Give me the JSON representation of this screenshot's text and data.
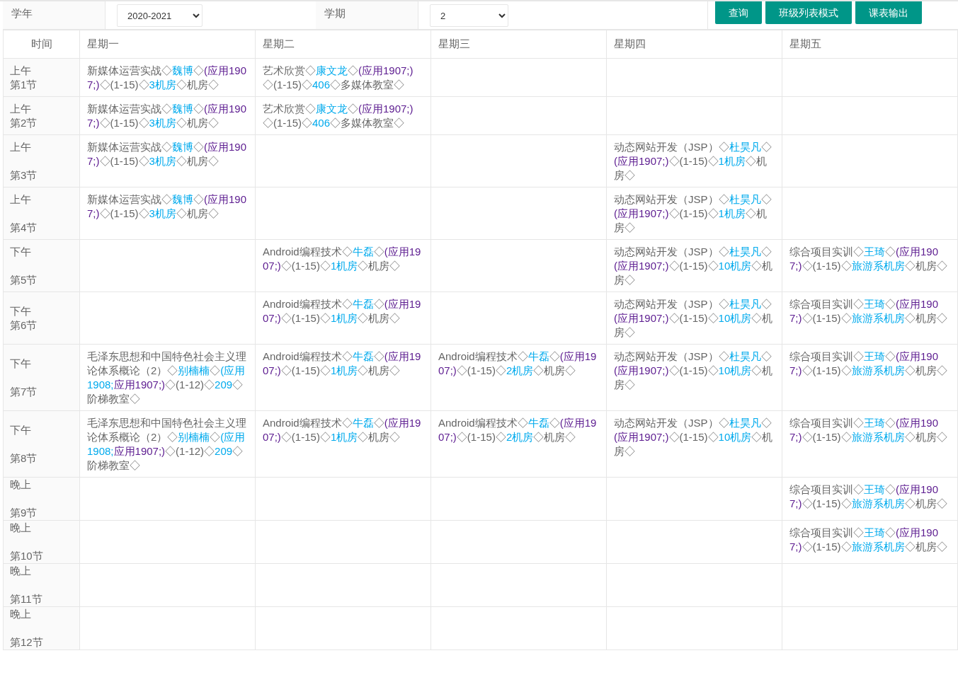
{
  "filters": [
    {
      "label": "学年",
      "value": "2020-2021"
    },
    {
      "label": "学期",
      "value": "2"
    }
  ],
  "buttons": [
    "查询",
    "班级列表模式",
    "课表输出"
  ],
  "table": {
    "columns": [
      "时间",
      "星期一",
      "星期二",
      "星期三",
      "星期四",
      "星期五"
    ],
    "rows": [
      {
        "cells": [
          {
            "part": "上午",
            "period": "第1节",
            "spaced": false
          },
          {
            "segments": [
              {
                "text": "新媒体运营实战◇",
                "kind": "text"
              },
              {
                "text": "魏博",
                "kind": "link"
              },
              {
                "text": "◇",
                "kind": "text"
              },
              {
                "text": "(应用1907;)",
                "kind": "visited"
              },
              {
                "text": "◇(1-15)◇",
                "kind": "text"
              },
              {
                "text": "3机房",
                "kind": "link"
              },
              {
                "text": "◇机房◇",
                "kind": "text"
              }
            ]
          },
          {
            "segments": [
              {
                "text": "艺术欣赏◇",
                "kind": "text"
              },
              {
                "text": "康文龙",
                "kind": "link"
              },
              {
                "text": "◇",
                "kind": "text"
              },
              {
                "text": "(应用1907;)",
                "kind": "visited"
              },
              {
                "text": "◇(1-15)◇",
                "kind": "text"
              },
              {
                "text": "406",
                "kind": "link"
              },
              {
                "text": "◇多媒体教室◇",
                "kind": "text"
              }
            ]
          },
          {},
          {},
          {}
        ]
      },
      {
        "cells": [
          {
            "part": "上午",
            "period": "第2节",
            "spaced": false
          },
          {
            "segments": [
              {
                "text": "新媒体运营实战◇",
                "kind": "text"
              },
              {
                "text": "魏博",
                "kind": "link"
              },
              {
                "text": "◇",
                "kind": "text"
              },
              {
                "text": "(应用1907;)",
                "kind": "visited"
              },
              {
                "text": "◇(1-15)◇",
                "kind": "text"
              },
              {
                "text": "3机房",
                "kind": "link"
              },
              {
                "text": "◇机房◇",
                "kind": "text"
              }
            ]
          },
          {
            "segments": [
              {
                "text": "艺术欣赏◇",
                "kind": "text"
              },
              {
                "text": "康文龙",
                "kind": "link"
              },
              {
                "text": "◇",
                "kind": "text"
              },
              {
                "text": "(应用1907;)",
                "kind": "visited"
              },
              {
                "text": "◇(1-15)◇",
                "kind": "text"
              },
              {
                "text": "406",
                "kind": "link"
              },
              {
                "text": "◇多媒体教室◇",
                "kind": "text"
              }
            ]
          },
          {},
          {},
          {}
        ]
      },
      {
        "cells": [
          {
            "part": "上午",
            "period": "第3节",
            "spaced": true
          },
          {
            "segments": [
              {
                "text": "新媒体运营实战◇",
                "kind": "text"
              },
              {
                "text": "魏博",
                "kind": "link"
              },
              {
                "text": "◇",
                "kind": "text"
              },
              {
                "text": "(应用1907;)",
                "kind": "visited"
              },
              {
                "text": "◇(1-15)◇",
                "kind": "text"
              },
              {
                "text": "3机房",
                "kind": "link"
              },
              {
                "text": "◇机房◇",
                "kind": "text"
              }
            ]
          },
          {},
          {},
          {
            "segments": [
              {
                "text": "动态网站开发（JSP）◇",
                "kind": "text"
              },
              {
                "text": "杜昊凡",
                "kind": "link"
              },
              {
                "text": "◇",
                "kind": "text"
              },
              {
                "text": "(应用1907;)",
                "kind": "visited"
              },
              {
                "text": "◇(1-15)◇",
                "kind": "text"
              },
              {
                "text": "1机房",
                "kind": "link"
              },
              {
                "text": "◇机房◇",
                "kind": "text"
              }
            ]
          },
          {}
        ]
      },
      {
        "cells": [
          {
            "part": "上午",
            "period": "第4节",
            "spaced": true
          },
          {
            "segments": [
              {
                "text": "新媒体运营实战◇",
                "kind": "text"
              },
              {
                "text": "魏博",
                "kind": "link"
              },
              {
                "text": "◇",
                "kind": "text"
              },
              {
                "text": "(应用1907;)",
                "kind": "visited"
              },
              {
                "text": "◇(1-15)◇",
                "kind": "text"
              },
              {
                "text": "3机房",
                "kind": "link"
              },
              {
                "text": "◇机房◇",
                "kind": "text"
              }
            ]
          },
          {},
          {},
          {
            "segments": [
              {
                "text": "动态网站开发（JSP）◇",
                "kind": "text"
              },
              {
                "text": "杜昊凡",
                "kind": "link"
              },
              {
                "text": "◇",
                "kind": "text"
              },
              {
                "text": "(应用1907;)",
                "kind": "visited"
              },
              {
                "text": "◇(1-15)◇",
                "kind": "text"
              },
              {
                "text": "1机房",
                "kind": "link"
              },
              {
                "text": "◇机房◇",
                "kind": "text"
              }
            ]
          },
          {}
        ]
      },
      {
        "cells": [
          {
            "part": "下午",
            "period": "第5节",
            "spaced": true
          },
          {},
          {
            "segments": [
              {
                "text": "Android编程技术◇",
                "kind": "text"
              },
              {
                "text": "牛磊",
                "kind": "link"
              },
              {
                "text": "◇",
                "kind": "text"
              },
              {
                "text": "(应用1907;)",
                "kind": "visited"
              },
              {
                "text": "◇(1-15)◇",
                "kind": "text"
              },
              {
                "text": "1机房",
                "kind": "link"
              },
              {
                "text": "◇机房◇",
                "kind": "text"
              }
            ]
          },
          {},
          {
            "segments": [
              {
                "text": "动态网站开发（JSP）◇",
                "kind": "text"
              },
              {
                "text": "杜昊凡",
                "kind": "link"
              },
              {
                "text": "◇",
                "kind": "text"
              },
              {
                "text": "(应用1907;)",
                "kind": "visited"
              },
              {
                "text": "◇(1-15)◇",
                "kind": "text"
              },
              {
                "text": "10机房",
                "kind": "link"
              },
              {
                "text": "◇机房◇",
                "kind": "text"
              }
            ]
          },
          {
            "segments": [
              {
                "text": "综合项目实训◇",
                "kind": "text"
              },
              {
                "text": "王琦",
                "kind": "link"
              },
              {
                "text": "◇",
                "kind": "text"
              },
              {
                "text": "(应用1907;)",
                "kind": "visited"
              },
              {
                "text": "◇(1-15)◇",
                "kind": "text"
              },
              {
                "text": "旅游系机房",
                "kind": "link"
              },
              {
                "text": "◇机房◇",
                "kind": "text"
              }
            ]
          }
        ]
      },
      {
        "cells": [
          {
            "part": "下午",
            "period": "第6节",
            "spaced": false
          },
          {},
          {
            "segments": [
              {
                "text": "Android编程技术◇",
                "kind": "text"
              },
              {
                "text": "牛磊",
                "kind": "link"
              },
              {
                "text": "◇",
                "kind": "text"
              },
              {
                "text": "(应用1907;)",
                "kind": "visited"
              },
              {
                "text": "◇(1-15)◇",
                "kind": "text"
              },
              {
                "text": "1机房",
                "kind": "link"
              },
              {
                "text": "◇机房◇",
                "kind": "text"
              }
            ]
          },
          {},
          {
            "segments": [
              {
                "text": "动态网站开发（JSP）◇",
                "kind": "text"
              },
              {
                "text": "杜昊凡",
                "kind": "link"
              },
              {
                "text": "◇",
                "kind": "text"
              },
              {
                "text": "(应用1907;)",
                "kind": "visited"
              },
              {
                "text": "◇(1-15)◇",
                "kind": "text"
              },
              {
                "text": "10机房",
                "kind": "link"
              },
              {
                "text": "◇机房◇",
                "kind": "text"
              }
            ]
          },
          {
            "segments": [
              {
                "text": "综合项目实训◇",
                "kind": "text"
              },
              {
                "text": "王琦",
                "kind": "link"
              },
              {
                "text": "◇",
                "kind": "text"
              },
              {
                "text": "(应用1907;)",
                "kind": "visited"
              },
              {
                "text": "◇(1-15)◇",
                "kind": "text"
              },
              {
                "text": "旅游系机房",
                "kind": "link"
              },
              {
                "text": "◇机房◇",
                "kind": "text"
              }
            ]
          }
        ]
      },
      {
        "cells": [
          {
            "part": "下午",
            "period": "第7节",
            "spaced": true
          },
          {
            "segments": [
              {
                "text": "毛泽东思想和中国特色社会主义理论体系概论（2）◇",
                "kind": "text"
              },
              {
                "text": "别楠楠",
                "kind": "link"
              },
              {
                "text": "◇",
                "kind": "text"
              },
              {
                "text": "(应用1908;",
                "kind": "link"
              },
              {
                "text": "应用1907;)",
                "kind": "visited"
              },
              {
                "text": "◇(1-12)◇",
                "kind": "text"
              },
              {
                "text": "209",
                "kind": "link"
              },
              {
                "text": "◇阶梯教室◇",
                "kind": "text"
              }
            ]
          },
          {
            "segments": [
              {
                "text": "Android编程技术◇",
                "kind": "text"
              },
              {
                "text": "牛磊",
                "kind": "link"
              },
              {
                "text": "◇",
                "kind": "text"
              },
              {
                "text": "(应用1907;)",
                "kind": "visited"
              },
              {
                "text": "◇(1-15)◇",
                "kind": "text"
              },
              {
                "text": "1机房",
                "kind": "link"
              },
              {
                "text": "◇机房◇",
                "kind": "text"
              }
            ]
          },
          {
            "segments": [
              {
                "text": "Android编程技术◇",
                "kind": "text"
              },
              {
                "text": "牛磊",
                "kind": "link"
              },
              {
                "text": "◇",
                "kind": "text"
              },
              {
                "text": "(应用1907;)",
                "kind": "visited"
              },
              {
                "text": "◇(1-15)◇",
                "kind": "text"
              },
              {
                "text": "2机房",
                "kind": "link"
              },
              {
                "text": "◇机房◇",
                "kind": "text"
              }
            ]
          },
          {
            "segments": [
              {
                "text": "动态网站开发（JSP）◇",
                "kind": "text"
              },
              {
                "text": "杜昊凡",
                "kind": "link"
              },
              {
                "text": "◇",
                "kind": "text"
              },
              {
                "text": "(应用1907;)",
                "kind": "visited"
              },
              {
                "text": "◇(1-15)◇",
                "kind": "text"
              },
              {
                "text": "10机房",
                "kind": "link"
              },
              {
                "text": "◇机房◇",
                "kind": "text"
              }
            ]
          },
          {
            "segments": [
              {
                "text": "综合项目实训◇",
                "kind": "text"
              },
              {
                "text": "王琦",
                "kind": "link"
              },
              {
                "text": "◇",
                "kind": "text"
              },
              {
                "text": "(应用1907;)",
                "kind": "visited"
              },
              {
                "text": "◇(1-15)◇",
                "kind": "text"
              },
              {
                "text": "旅游系机房",
                "kind": "link"
              },
              {
                "text": "◇机房◇",
                "kind": "text"
              }
            ]
          }
        ]
      },
      {
        "cells": [
          {
            "part": "下午",
            "period": "第8节",
            "spaced": true
          },
          {
            "segments": [
              {
                "text": "毛泽东思想和中国特色社会主义理论体系概论（2）◇",
                "kind": "text"
              },
              {
                "text": "别楠楠",
                "kind": "link"
              },
              {
                "text": "◇",
                "kind": "text"
              },
              {
                "text": "(应用1908;",
                "kind": "link"
              },
              {
                "text": "应用1907;)",
                "kind": "visited"
              },
              {
                "text": "◇(1-12)◇",
                "kind": "text"
              },
              {
                "text": "209",
                "kind": "link"
              },
              {
                "text": "◇阶梯教室◇",
                "kind": "text"
              }
            ]
          },
          {
            "segments": [
              {
                "text": "Android编程技术◇",
                "kind": "text"
              },
              {
                "text": "牛磊",
                "kind": "link"
              },
              {
                "text": "◇",
                "kind": "text"
              },
              {
                "text": "(应用1907;)",
                "kind": "visited"
              },
              {
                "text": "◇(1-15)◇",
                "kind": "text"
              },
              {
                "text": "1机房",
                "kind": "link"
              },
              {
                "text": "◇机房◇",
                "kind": "text"
              }
            ]
          },
          {
            "segments": [
              {
                "text": "Android编程技术◇",
                "kind": "text"
              },
              {
                "text": "牛磊",
                "kind": "link"
              },
              {
                "text": "◇",
                "kind": "text"
              },
              {
                "text": "(应用1907;)",
                "kind": "visited"
              },
              {
                "text": "◇(1-15)◇",
                "kind": "text"
              },
              {
                "text": "2机房",
                "kind": "link"
              },
              {
                "text": "◇机房◇",
                "kind": "text"
              }
            ]
          },
          {
            "segments": [
              {
                "text": "动态网站开发（JSP）◇",
                "kind": "text"
              },
              {
                "text": "杜昊凡",
                "kind": "link"
              },
              {
                "text": "◇",
                "kind": "text"
              },
              {
                "text": "(应用1907;)",
                "kind": "visited"
              },
              {
                "text": "◇(1-15)◇",
                "kind": "text"
              },
              {
                "text": "10机房",
                "kind": "link"
              },
              {
                "text": "◇机房◇",
                "kind": "text"
              }
            ]
          },
          {
            "segments": [
              {
                "text": "综合项目实训◇",
                "kind": "text"
              },
              {
                "text": "王琦",
                "kind": "link"
              },
              {
                "text": "◇",
                "kind": "text"
              },
              {
                "text": "(应用1907;)",
                "kind": "visited"
              },
              {
                "text": "◇(1-15)◇",
                "kind": "text"
              },
              {
                "text": "旅游系机房",
                "kind": "link"
              },
              {
                "text": "◇机房◇",
                "kind": "text"
              }
            ]
          }
        ]
      },
      {
        "cells": [
          {
            "part": "晚上",
            "period": "第9节",
            "spaced": true
          },
          {},
          {},
          {},
          {},
          {
            "segments": [
              {
                "text": "综合项目实训◇",
                "kind": "text"
              },
              {
                "text": "王琦",
                "kind": "link"
              },
              {
                "text": "◇",
                "kind": "text"
              },
              {
                "text": "(应用1907;)",
                "kind": "visited"
              },
              {
                "text": "◇(1-15)◇",
                "kind": "text"
              },
              {
                "text": "旅游系机房",
                "kind": "link"
              },
              {
                "text": "◇机房◇",
                "kind": "text"
              }
            ]
          }
        ]
      },
      {
        "cells": [
          {
            "part": "晚上",
            "period": "第10节",
            "spaced": true
          },
          {},
          {},
          {},
          {},
          {
            "segments": [
              {
                "text": "综合项目实训◇",
                "kind": "text"
              },
              {
                "text": "王琦",
                "kind": "link"
              },
              {
                "text": "◇",
                "kind": "text"
              },
              {
                "text": "(应用1907;)",
                "kind": "visited"
              },
              {
                "text": "◇(1-15)◇",
                "kind": "text"
              },
              {
                "text": "旅游系机房",
                "kind": "link"
              },
              {
                "text": "◇机房◇",
                "kind": "text"
              }
            ]
          }
        ]
      },
      {
        "cells": [
          {
            "part": "晚上",
            "period": "第11节",
            "spaced": true
          },
          {},
          {},
          {},
          {},
          {}
        ]
      },
      {
        "cells": [
          {
            "part": "晚上",
            "period": "第12节",
            "spaced": true
          },
          {},
          {},
          {},
          {},
          {}
        ]
      }
    ]
  }
}
